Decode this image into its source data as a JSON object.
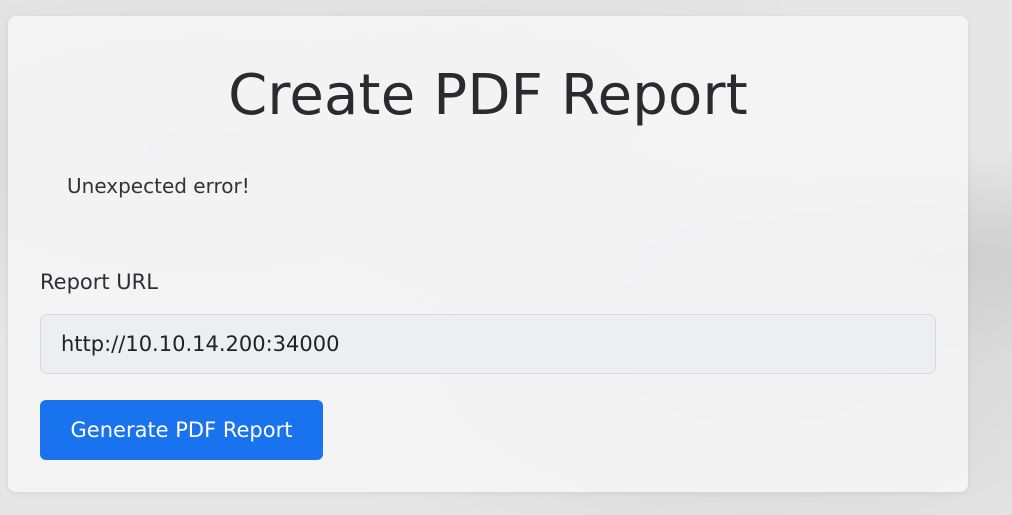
{
  "form": {
    "title": "Create PDF Report",
    "error_message": "Unexpected error!",
    "url_label": "Report URL",
    "url_value": "http://10.10.14.200:34000",
    "submit_label": "Generate PDF Report"
  },
  "colors": {
    "button": "#1a73ee",
    "button_text": "#ffffff",
    "card": "#f6f6f7"
  }
}
